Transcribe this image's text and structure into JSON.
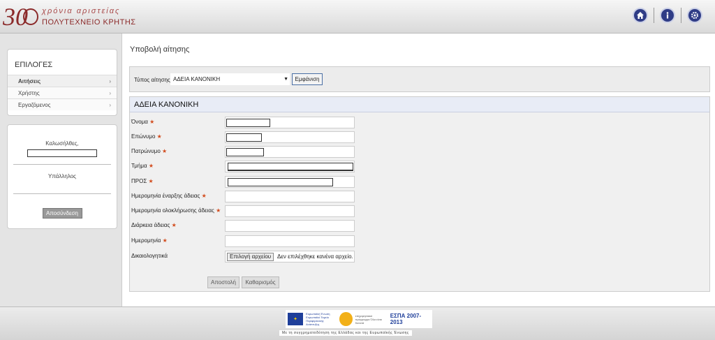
{
  "header": {
    "logo_numeral": "30",
    "logo_tagline": "χρόνια αριστείας",
    "logo_institution": "ΠΟΛΥΤΕΧΝΕΙΟ ΚΡΗΤΗΣ",
    "icons": [
      "home-icon",
      "info-icon",
      "settings-icon"
    ]
  },
  "sidebar": {
    "menu_title": "ΕΠΙΛΟΓΕΣ",
    "items": [
      {
        "label": "Αιτήσεις",
        "active": true
      },
      {
        "label": "Χρήστης",
        "active": false
      },
      {
        "label": "Εργαζόμενος",
        "active": false
      }
    ],
    "welcome": "Καλωσήλθες,",
    "role": "Υπάλληλος",
    "logout_label": "Αποσύνδεση"
  },
  "main": {
    "page_title": "Υποβολή αίτησης",
    "type_label": "Τύπος αίτησης:",
    "type_selected": "ΑΔΕΙΑ ΚΑΝΟΝΙΚΗ",
    "show_button": "Εμφάνιση",
    "form_title": "ΑΔΕΙΑ ΚΑΝΟΝΙΚΗ",
    "fields": [
      {
        "label": "Όνομα",
        "required": true
      },
      {
        "label": "Επώνυμο",
        "required": true
      },
      {
        "label": "Πατρώνυμο",
        "required": true
      },
      {
        "label": "Τμήμα",
        "required": true
      },
      {
        "label": "ΠΡΟΣ",
        "required": true
      },
      {
        "label": "Ημερομηνία έναρξης άδειας",
        "required": true
      },
      {
        "label": "Ημερομηνία ολοκλήρωσης άδειας",
        "required": true
      },
      {
        "label": "Διάρκεια άδειας",
        "required": true
      },
      {
        "label": "Ημερομηνία",
        "required": true
      },
      {
        "label": "Δικαιολογητικά",
        "required": false
      }
    ],
    "star": "★",
    "file_button": "Επιλογή αρχείου",
    "file_status": "Δεν επιλέχθηκε κανένα αρχείο.",
    "submit_label": "Αποστολή",
    "clear_label": "Καθαρισμός"
  },
  "footer": {
    "eu_text": "Ευρωπαϊκή Ένωση Ευρωπαϊκό Ταμείο Περιφερειακής Ανάπτυξης",
    "program_text": "επιχειρησιακό πρόγραμμα Όλα είναι δυνατά",
    "espa_text": "ΕΣΠΑ 2007-2013",
    "note": "Με τη συγχρηματοδότηση της Ελλάδας και της Ευρωπαϊκής Ένωσης"
  },
  "colors": {
    "accent_blue": "#2f3c86",
    "required_star": "#d24b1c",
    "logo_red": "#8b2a2a"
  }
}
